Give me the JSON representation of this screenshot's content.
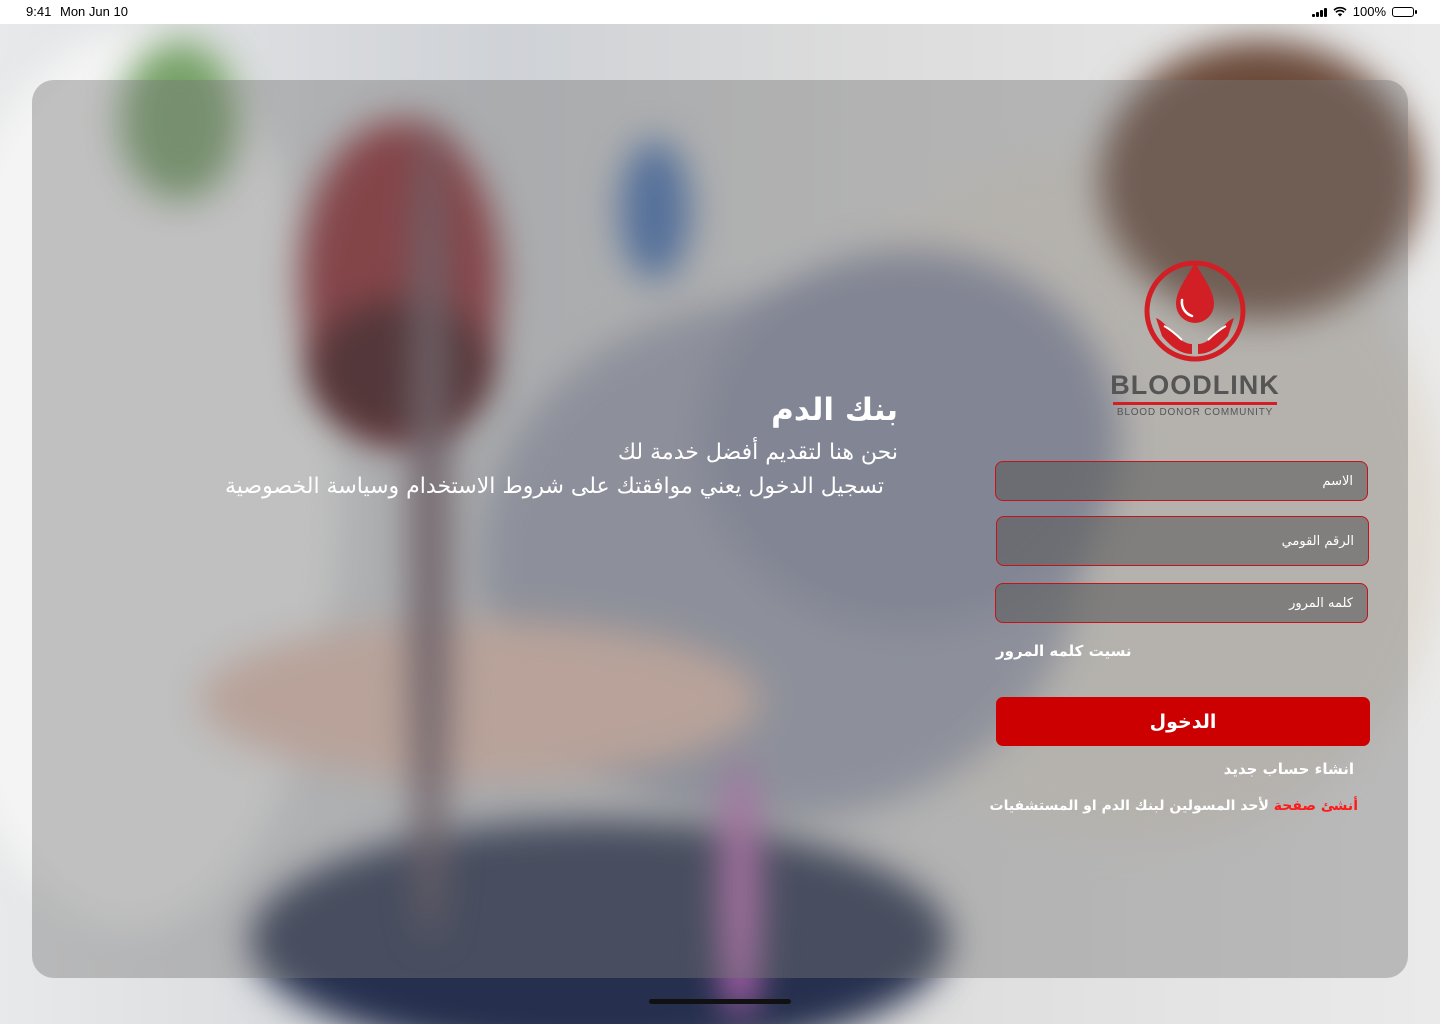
{
  "status_bar": {
    "time": "9:41",
    "date": "Mon Jun 10",
    "battery": "100%"
  },
  "hero": {
    "title": "بنك الدم",
    "subtitle": "نحن هنا لتقديم أفضل خدمة لك",
    "terms": "تسجيل الدخول يعني موافقتك على شروط الاستخدام وسياسة الخصوصية"
  },
  "logo": {
    "brand": "BLOODLINK",
    "tagline": "BLOOD DONOR COMMUNITY",
    "color": "#d21f26"
  },
  "form": {
    "name_placeholder": "الاسم",
    "national_id_placeholder": "الرقم القومي",
    "password_placeholder": "كلمه المرور",
    "forgot_password": "نسيت كلمه المرور",
    "login_label": "الدخول",
    "create_account": "انشاء حساب جديد",
    "admin_link": "أنشئ صفحة",
    "admin_text": " لأحد المسولين لبنك الدم او المستشفيات"
  },
  "colors": {
    "accent": "#cc0000",
    "link_red": "#ff1a1a"
  }
}
